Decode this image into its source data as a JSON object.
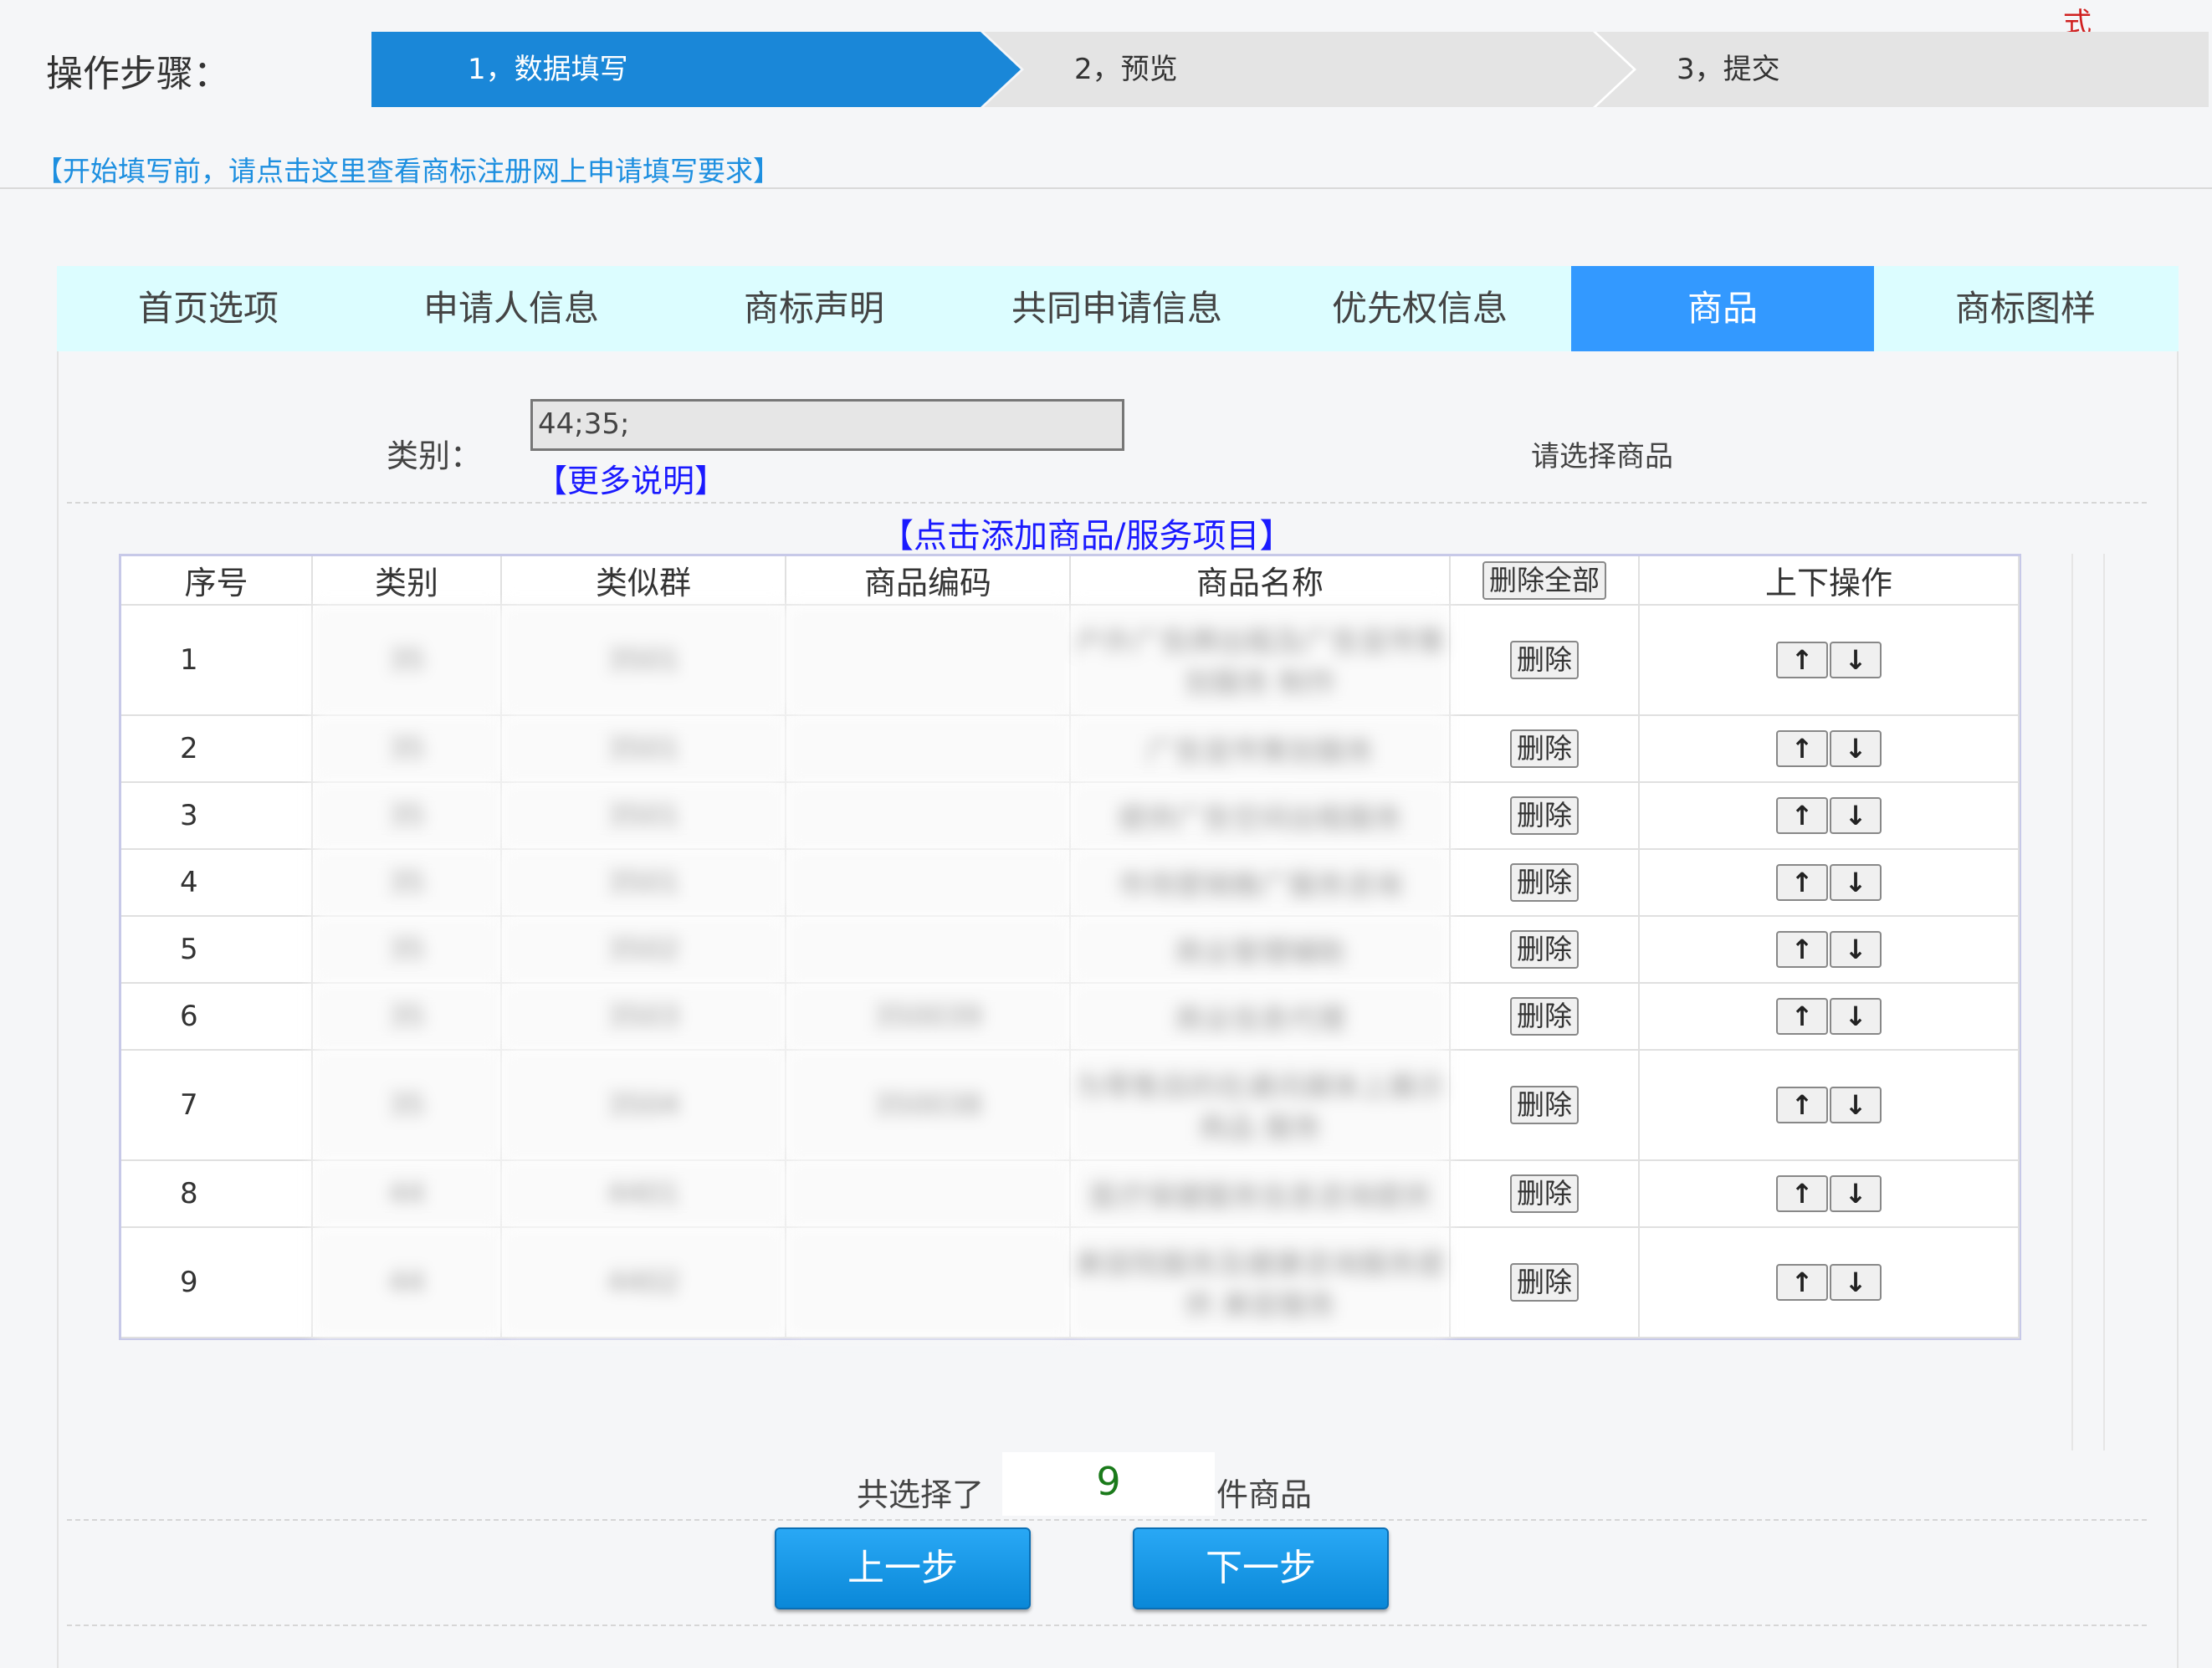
{
  "steps": {
    "label": "操作步骤：",
    "items": [
      "1，数据填写",
      "2，预览",
      "3，提交"
    ],
    "corner_mark": "式"
  },
  "notice_link": "【开始填写前，请点击这里查看商标注册网上申请填写要求】",
  "tabs": [
    "首页选项",
    "申请人信息",
    "商标声明",
    "共同申请信息",
    "优先权信息",
    "商品",
    "商标图样"
  ],
  "active_tab": "商品",
  "form": {
    "category_label": "类别：",
    "category_value": "44;35;",
    "more_info_link": "【更多说明】",
    "choose_goods_label": "请选择商品",
    "add_goods_link": "【点击添加商品/服务项目】"
  },
  "table": {
    "headers": [
      "序号",
      "类别",
      "类似群",
      "商品编码",
      "商品名称",
      "删除全部",
      "上下操作"
    ],
    "delete_label": "删除",
    "up_label": "↑",
    "down_label": "↓",
    "rows": [
      {
        "seq": "1",
        "category": "35",
        "group": "3501",
        "code": "",
        "name": "户外广告牌出租及广告宣传策划服务 制作"
      },
      {
        "seq": "2",
        "category": "35",
        "group": "3501",
        "code": "",
        "name": "广告宣传策划服务"
      },
      {
        "seq": "3",
        "category": "35",
        "group": "3501",
        "code": "",
        "name": "提供广告空间出租服务"
      },
      {
        "seq": "4",
        "category": "35",
        "group": "3501",
        "code": "",
        "name": "市场营销推广服务咨询"
      },
      {
        "seq": "5",
        "category": "35",
        "group": "3502",
        "code": "",
        "name": "商业管理辅助"
      },
      {
        "seq": "6",
        "category": "35",
        "group": "3503",
        "code": "350039",
        "name": "商业信息代理"
      },
      {
        "seq": "7",
        "category": "35",
        "group": "3504",
        "code": "350038",
        "name": "为零售目的在通讯媒体上展示商品 服务"
      },
      {
        "seq": "8",
        "category": "44",
        "group": "4401",
        "code": "",
        "name": "医疗保健服务信息咨询提供"
      },
      {
        "seq": "9",
        "category": "44",
        "group": "4402",
        "code": "",
        "name": "美容院服务及健康咨询服务提供 美容服务"
      }
    ]
  },
  "footer": {
    "count_prefix": "共选择了",
    "count_value": "9",
    "count_suffix": "件商品",
    "prev_button": "上一步",
    "next_button": "下一步"
  }
}
